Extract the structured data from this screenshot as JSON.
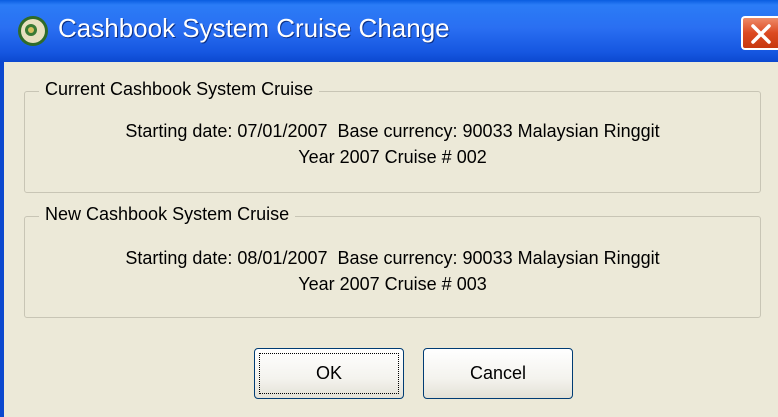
{
  "window": {
    "title": "Cashbook System Cruise Change",
    "app_icon": "sun-app-icon",
    "close_icon": "close-icon",
    "title_color": "#2a6ff2",
    "close_color": "#dc4a22"
  },
  "current_group": {
    "legend": "Current Cashbook System Cruise",
    "line1": "Starting date: 07/01/2007  Base currency: 90033 Malaysian Ringgit",
    "line2": "Year 2007 Cruise # 002"
  },
  "new_group": {
    "legend": "New Cashbook System Cruise",
    "line1": "Starting date: 08/01/2007  Base currency: 90033 Malaysian Ringgit",
    "line2": "Year 2007 Cruise # 003"
  },
  "buttons": {
    "ok": "OK",
    "cancel": "Cancel"
  }
}
